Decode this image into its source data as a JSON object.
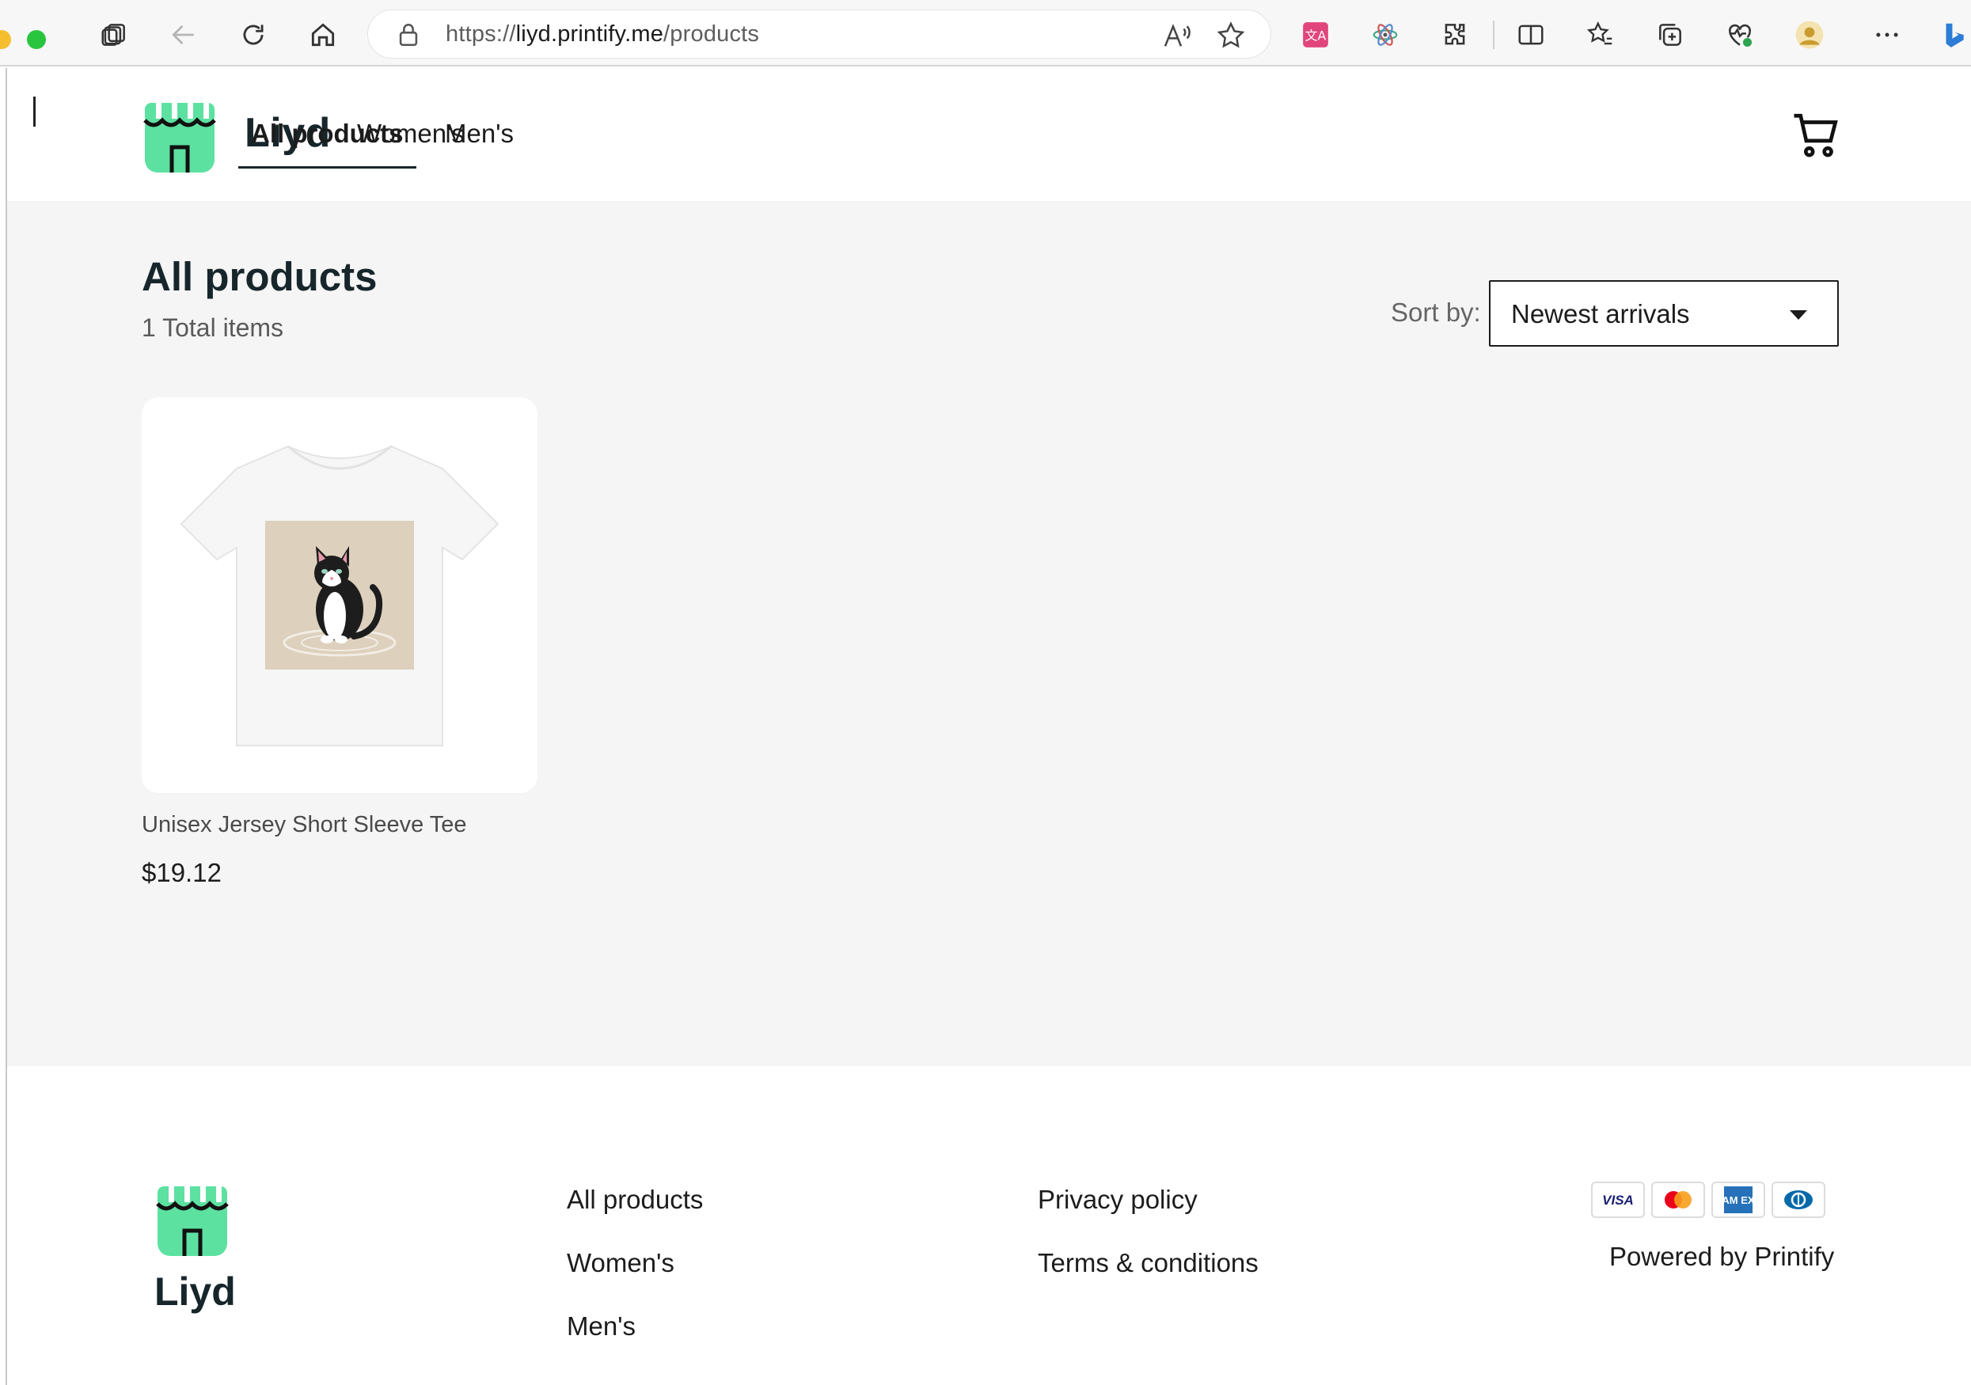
{
  "browser": {
    "url_prefix": "https://",
    "url_host": "liyd.printify.me",
    "url_path": "/products"
  },
  "store": {
    "name": "Liyd",
    "brand_color": "#5ce1a1"
  },
  "nav": {
    "items": [
      {
        "label": "All products",
        "active": true
      },
      {
        "label": "Women's",
        "active": false
      },
      {
        "label": "Men's",
        "active": false
      }
    ]
  },
  "main": {
    "title": "All products",
    "total_items": "1 Total items",
    "sort_label": "Sort by:",
    "sort_value": "Newest arrivals"
  },
  "products": [
    {
      "name": "Unisex Jersey Short Sleeve Tee",
      "price": "$19.12"
    }
  ],
  "footer": {
    "links_col1": [
      "All products",
      "Women's",
      "Men's"
    ],
    "links_col2": [
      "Privacy policy",
      "Terms & conditions"
    ],
    "payment_methods": [
      "visa-icon",
      "mastercard-icon",
      "amex-icon",
      "diners-icon"
    ],
    "payment_labels": {
      "visa": "VISA",
      "amex": "AM EX"
    },
    "powered_by": "Powered by Printify"
  }
}
